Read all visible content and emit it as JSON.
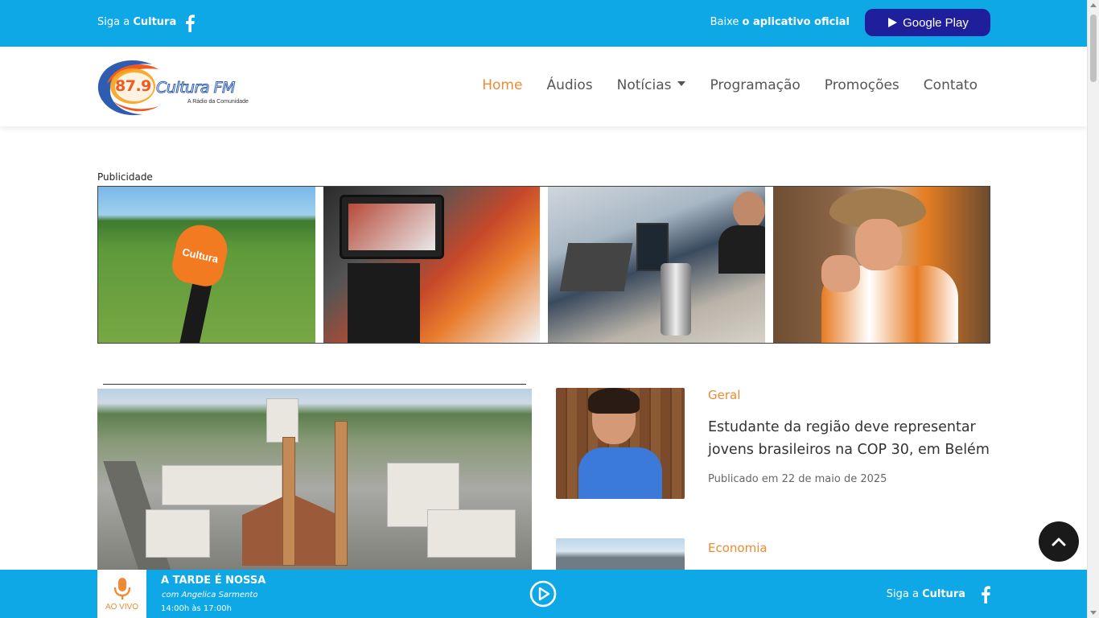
{
  "topbar": {
    "follow_prefix": "Siga a ",
    "follow_brand": "Cultura",
    "download_prefix": "Baixe ",
    "download_bold": "o aplicativo oficial",
    "google_play_label": "Google Play",
    "colors": {
      "bar": "#0fa8e6",
      "button": "#1f1f9b"
    }
  },
  "logo": {
    "frequency": "87.9",
    "name": "Cultura FM",
    "tagline": "A Rádio da Comunidade"
  },
  "nav": {
    "items": [
      "Home",
      "Áudios",
      "Notícias",
      "Programação",
      "Promoções",
      "Contato"
    ],
    "active": "Home",
    "accent": "#ef8a33"
  },
  "ads": {
    "label": "Publicidade",
    "mic_text": "Cultura"
  },
  "news": [
    {
      "category": "Geral",
      "headline": "Estudante da região deve representar jovens brasileiros na COP 30, em Belém",
      "date": "Publicado em 22 de maio de 2025"
    },
    {
      "category": "Economia"
    }
  ],
  "player": {
    "live_label": "AO VIVO",
    "show_title": "A TARDE É NOSSA",
    "show_host": "com Angelica Sarmento",
    "show_time": "14:00h às 17:00h",
    "follow_prefix": "Siga a ",
    "follow_brand": "Cultura"
  }
}
